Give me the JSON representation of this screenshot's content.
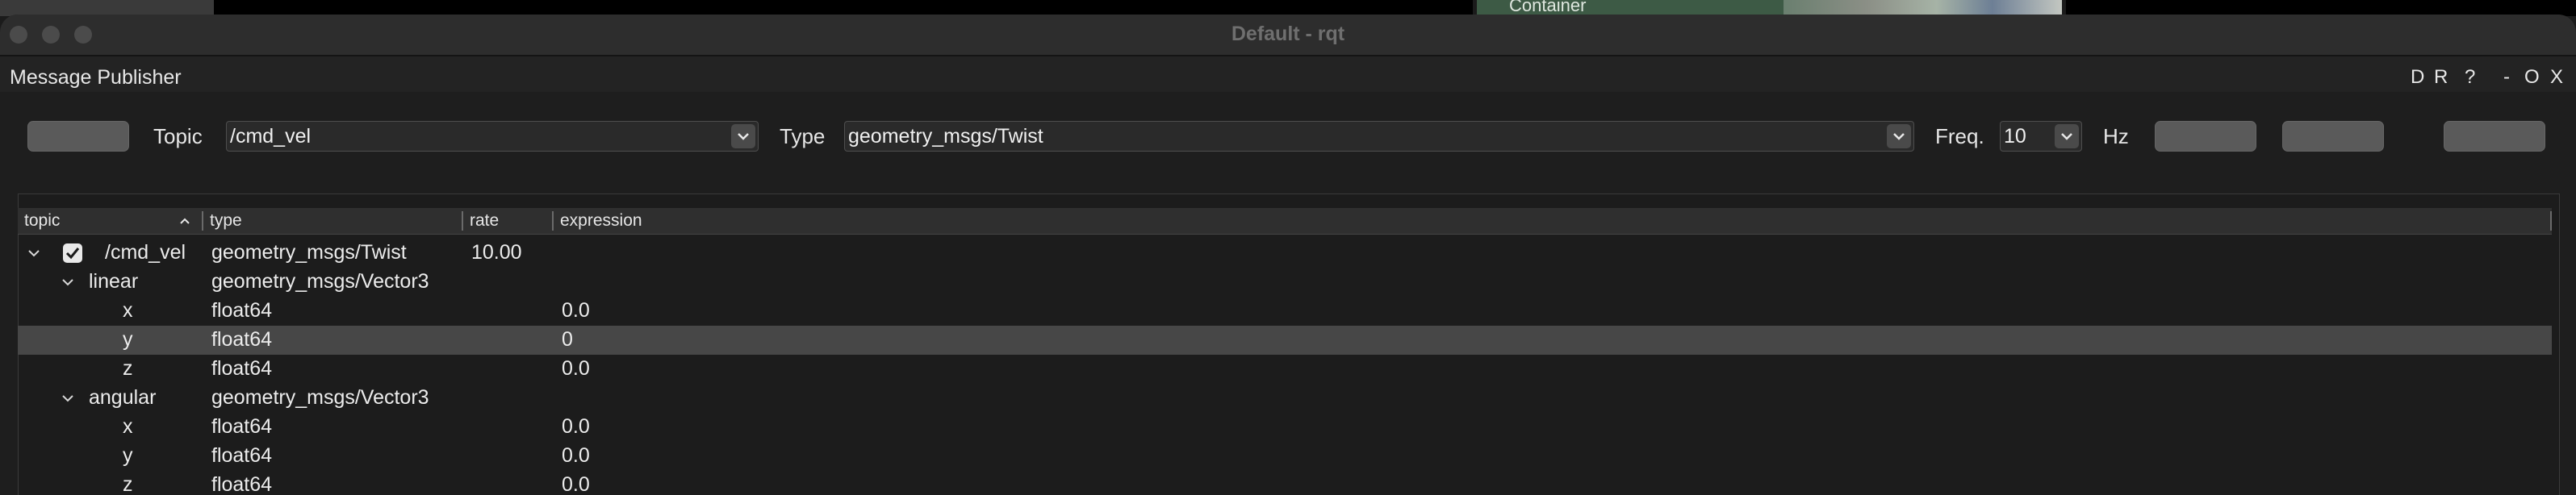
{
  "background": {
    "behind_window_label": "Container"
  },
  "window": {
    "title": "Default - rqt"
  },
  "plugin": {
    "title": "Message Publisher",
    "header_controls": [
      "D",
      "R",
      "?",
      "-",
      "O",
      "X"
    ]
  },
  "toolbar": {
    "topic_label": "Topic",
    "topic_value": "/cmd_vel",
    "type_label": "Type",
    "type_value": "geometry_msgs/Twist",
    "freq_label": "Freq.",
    "freq_value": "10",
    "hz_label": "Hz"
  },
  "tree": {
    "columns": [
      "topic",
      "type",
      "rate",
      "expression"
    ],
    "sort_column": "topic",
    "rows": [
      {
        "topic": "/cmd_vel",
        "type": "geometry_msgs/Twist",
        "rate": "10.00",
        "expression": "",
        "checked": true,
        "level": 0,
        "expanded": true
      },
      {
        "topic": "linear",
        "type": "geometry_msgs/Vector3",
        "rate": "",
        "expression": "",
        "level": 1,
        "expanded": true
      },
      {
        "topic": "x",
        "type": "float64",
        "rate": "",
        "expression": "0.0",
        "level": 2
      },
      {
        "topic": "y",
        "type": "float64",
        "rate": "",
        "expression": "0",
        "level": 2,
        "selected": true
      },
      {
        "topic": "z",
        "type": "float64",
        "rate": "",
        "expression": "0.0",
        "level": 2
      },
      {
        "topic": "angular",
        "type": "geometry_msgs/Vector3",
        "rate": "",
        "expression": "",
        "level": 1,
        "expanded": true
      },
      {
        "topic": "x",
        "type": "float64",
        "rate": "",
        "expression": "0.0",
        "level": 2
      },
      {
        "topic": "y",
        "type": "float64",
        "rate": "",
        "expression": "0.0",
        "level": 2
      },
      {
        "topic": "z",
        "type": "float64",
        "rate": "",
        "expression": "0.0",
        "level": 2
      }
    ]
  },
  "colors": {
    "selection": "#474747",
    "background": "#1e1e1e",
    "button": "#5a5a5a"
  }
}
